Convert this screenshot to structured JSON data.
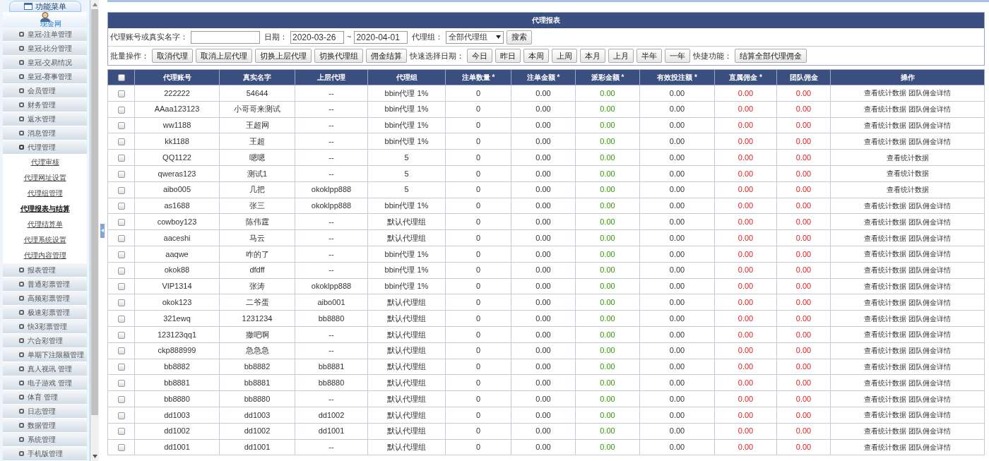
{
  "sidebar": {
    "title": "功能菜单",
    "site": "现金网",
    "items": [
      {
        "label": "皇冠-注单管理",
        "expanded": false
      },
      {
        "label": "皇冠-比分管理",
        "expanded": false
      },
      {
        "label": "皇冠-交易情况",
        "expanded": false
      },
      {
        "label": "皇冠-赛事管理",
        "expanded": false
      },
      {
        "label": "会员管理",
        "expanded": false
      },
      {
        "label": "财务管理",
        "expanded": false
      },
      {
        "label": "返水管理",
        "expanded": false
      },
      {
        "label": "消息管理",
        "expanded": false
      },
      {
        "label": "代理管理",
        "expanded": true,
        "children": [
          {
            "label": "代理审核",
            "selected": false
          },
          {
            "label": "代理网址设置",
            "selected": false
          },
          {
            "label": "代理组管理",
            "selected": false
          },
          {
            "label": "代理报表与结算",
            "selected": true
          },
          {
            "label": "代理结算单",
            "selected": false
          },
          {
            "label": "代理系统设置",
            "selected": false
          },
          {
            "label": "代理内容管理",
            "selected": false
          }
        ]
      },
      {
        "label": "报表管理",
        "expanded": false
      },
      {
        "label": "普通彩票管理",
        "expanded": false
      },
      {
        "label": "高频彩票管理",
        "expanded": false
      },
      {
        "label": "极速彩票管理",
        "expanded": false
      },
      {
        "label": "快3彩票管理",
        "expanded": false
      },
      {
        "label": "六合彩管理",
        "expanded": false
      },
      {
        "label": "单期下注限额管理",
        "expanded": false
      },
      {
        "label": "真人视讯 管理",
        "expanded": false
      },
      {
        "label": "电子游戏 管理",
        "expanded": false
      },
      {
        "label": "体育 管理",
        "expanded": false
      },
      {
        "label": "日志管理",
        "expanded": false
      },
      {
        "label": "数据管理",
        "expanded": false
      },
      {
        "label": "系统管理",
        "expanded": false
      },
      {
        "label": "手机版管理",
        "expanded": false
      }
    ]
  },
  "panel": {
    "title": "代理报表",
    "filter": {
      "account_label": "代理账号或真实名字：",
      "date_label": "日期：",
      "date_from": "2020-03-26",
      "date_sep": "~",
      "date_to": "2020-04-01",
      "group_label": "代理组：",
      "group_value": "全部代理组",
      "search_button": "搜索"
    },
    "batch": {
      "label": "批量操作：",
      "buttons": [
        "取消代理",
        "取消上层代理",
        "切换上层代理",
        "切换代理组",
        "佣金结算"
      ],
      "quick_label": "快速选择日期：",
      "quick_buttons": [
        "今日",
        "昨日",
        "本周",
        "上周",
        "本月",
        "上月",
        "半年",
        "一年"
      ],
      "shortcut_label": "快捷功能：",
      "shortcut_button": "结算全部代理佣金"
    },
    "table": {
      "select_all": {
        "checked": false
      },
      "columns": [
        "代理账号",
        "真实名字",
        "上层代理",
        "代理组",
        "注单数量 *",
        "注单金额 *",
        "派彩金额 *",
        "有效投注额 *",
        "直属佣金 *",
        "团队佣金",
        "操作"
      ],
      "rows": [
        {
          "checked": false,
          "cells": [
            "222222",
            "54644",
            "--",
            "bbin代理 1%",
            "0",
            "0.00",
            "0.00",
            "0.00",
            "0.00",
            "0.00"
          ],
          "actions": [
            "查看统计数据",
            "团队佣金详情"
          ]
        },
        {
          "checked": false,
          "cells": [
            "AAaa123123",
            "小哥哥来测试",
            "--",
            "bbin代理 1%",
            "0",
            "0.00",
            "0.00",
            "0.00",
            "0.00",
            "0.00"
          ],
          "actions": [
            "查看统计数据",
            "团队佣金详情"
          ]
        },
        {
          "checked": false,
          "cells": [
            "ww1188",
            "王超网",
            "--",
            "bbin代理 1%",
            "0",
            "0.00",
            "0.00",
            "0.00",
            "0.00",
            "0.00"
          ],
          "actions": [
            "查看统计数据",
            "团队佣金详情"
          ]
        },
        {
          "checked": false,
          "cells": [
            "kk1188",
            "王超",
            "--",
            "bbin代理 1%",
            "0",
            "0.00",
            "0.00",
            "0.00",
            "0.00",
            "0.00"
          ],
          "actions": [
            "查看统计数据",
            "团队佣金详情"
          ]
        },
        {
          "checked": false,
          "cells": [
            "QQ1122",
            "嗯嗯",
            "--",
            "5",
            "0",
            "0.00",
            "0.00",
            "0.00",
            "0.00",
            "0.00"
          ],
          "actions": [
            "查看统计数据"
          ]
        },
        {
          "checked": false,
          "cells": [
            "qweras123",
            "测试1",
            "--",
            "5",
            "0",
            "0.00",
            "0.00",
            "0.00",
            "0.00",
            "0.00"
          ],
          "actions": [
            "查看统计数据"
          ]
        },
        {
          "checked": false,
          "cells": [
            "aibo005",
            "几把",
            "okoklpp888",
            "5",
            "0",
            "0.00",
            "0.00",
            "0.00",
            "0.00",
            "0.00"
          ],
          "actions": [
            "查看统计数据"
          ]
        },
        {
          "checked": false,
          "cells": [
            "as1688",
            "张三",
            "okoklpp888",
            "bbin代理 1%",
            "0",
            "0.00",
            "0.00",
            "0.00",
            "0.00",
            "0.00"
          ],
          "actions": [
            "查看统计数据",
            "团队佣金详情"
          ]
        },
        {
          "checked": false,
          "cells": [
            "cowboy123",
            "陈伟霆",
            "--",
            "默认代理组",
            "0",
            "0.00",
            "0.00",
            "0.00",
            "0.00",
            "0.00"
          ],
          "actions": [
            "查看统计数据",
            "团队佣金详情"
          ]
        },
        {
          "checked": false,
          "cells": [
            "aaceshi",
            "马云",
            "--",
            "默认代理组",
            "0",
            "0.00",
            "0.00",
            "0.00",
            "0.00",
            "0.00"
          ],
          "actions": [
            "查看统计数据",
            "团队佣金详情"
          ]
        },
        {
          "checked": false,
          "cells": [
            "aaqwe",
            "咋的了",
            "--",
            "bbin代理 1%",
            "0",
            "0.00",
            "0.00",
            "0.00",
            "0.00",
            "0.00"
          ],
          "actions": [
            "查看统计数据",
            "团队佣金详情"
          ]
        },
        {
          "checked": false,
          "cells": [
            "okok88",
            "dfdff",
            "--",
            "bbin代理 1%",
            "0",
            "0.00",
            "0.00",
            "0.00",
            "0.00",
            "0.00"
          ],
          "actions": [
            "查看统计数据",
            "团队佣金详情"
          ]
        },
        {
          "checked": false,
          "cells": [
            "VIP1314",
            "张涛",
            "okoklpp888",
            "bbin代理 1%",
            "0",
            "0.00",
            "0.00",
            "0.00",
            "0.00",
            "0.00"
          ],
          "actions": [
            "查看统计数据",
            "团队佣金详情"
          ]
        },
        {
          "checked": false,
          "cells": [
            "okok123",
            "二爷蛋",
            "aibo001",
            "默认代理组",
            "0",
            "0.00",
            "0.00",
            "0.00",
            "0.00",
            "0.00"
          ],
          "actions": [
            "查看统计数据",
            "团队佣金详情"
          ]
        },
        {
          "checked": false,
          "cells": [
            "321ewq",
            "1231234",
            "bb8880",
            "默认代理组",
            "0",
            "0.00",
            "0.00",
            "0.00",
            "0.00",
            "0.00"
          ],
          "actions": [
            "查看统计数据",
            "团队佣金详情"
          ]
        },
        {
          "checked": false,
          "cells": [
            "123123qq1",
            "撒吧啊",
            "--",
            "默认代理组",
            "0",
            "0.00",
            "0.00",
            "0.00",
            "0.00",
            "0.00"
          ],
          "actions": [
            "查看统计数据",
            "团队佣金详情"
          ]
        },
        {
          "checked": false,
          "cells": [
            "ckp888999",
            "急急急",
            "--",
            "默认代理组",
            "0",
            "0.00",
            "0.00",
            "0.00",
            "0.00",
            "0.00"
          ],
          "actions": [
            "查看统计数据",
            "团队佣金详情"
          ]
        },
        {
          "checked": false,
          "cells": [
            "bb8882",
            "bb8882",
            "bb8881",
            "默认代理组",
            "0",
            "0.00",
            "0.00",
            "0.00",
            "0.00",
            "0.00"
          ],
          "actions": [
            "查看统计数据",
            "团队佣金详情"
          ]
        },
        {
          "checked": false,
          "cells": [
            "bb8881",
            "bb8881",
            "bb8880",
            "默认代理组",
            "0",
            "0.00",
            "0.00",
            "0.00",
            "0.00",
            "0.00"
          ],
          "actions": [
            "查看统计数据",
            "团队佣金详情"
          ]
        },
        {
          "checked": false,
          "cells": [
            "bb8880",
            "bb8880",
            "--",
            "默认代理组",
            "0",
            "0.00",
            "0.00",
            "0.00",
            "0.00",
            "0.00"
          ],
          "actions": [
            "查看统计数据",
            "团队佣金详情"
          ]
        },
        {
          "checked": false,
          "cells": [
            "dd1003",
            "dd1003",
            "dd1002",
            "默认代理组",
            "0",
            "0.00",
            "0.00",
            "0.00",
            "0.00",
            "0.00"
          ],
          "actions": [
            "查看统计数据",
            "团队佣金详情"
          ]
        },
        {
          "checked": false,
          "cells": [
            "dd1002",
            "dd1002",
            "dd1001",
            "默认代理组",
            "0",
            "0.00",
            "0.00",
            "0.00",
            "0.00",
            "0.00"
          ],
          "actions": [
            "查看统计数据",
            "团队佣金详情"
          ]
        },
        {
          "checked": false,
          "cells": [
            "dd1001",
            "dd1001",
            "--",
            "默认代理组",
            "0",
            "0.00",
            "0.00",
            "0.00",
            "0.00",
            "0.00"
          ],
          "actions": [
            "查看统计数据",
            "团队佣金详情"
          ]
        }
      ]
    }
  }
}
